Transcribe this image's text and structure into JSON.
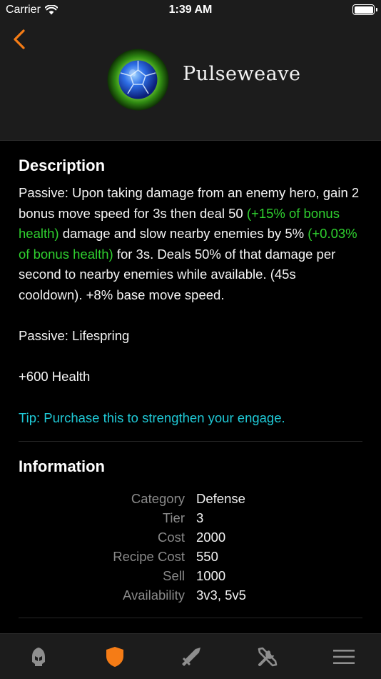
{
  "status_bar": {
    "carrier": "Carrier",
    "time": "1:39 AM",
    "battery_level": 1.0
  },
  "item": {
    "name": "Pulseweave",
    "icon": "pulseweave-orb-icon"
  },
  "description": {
    "title": "Description",
    "text_1": "Passive: Upon taking damage from an enemy hero, gain 2 bonus move speed for 3s then deal 50 ",
    "green_1": "(+15% of bonus health)",
    "text_2": " damage and slow nearby enemies by 5% ",
    "green_2": "(+0.03% of bonus health)",
    "text_3": " for 3s. Deals 50% of that damage per second to nearby enemies while available. (45s cooldown). +8% base move speed.",
    "passive": "Passive: Lifespring",
    "stat": "+600 Health",
    "tip": "Tip: Purchase this to strengthen your engage."
  },
  "information": {
    "title": "Information",
    "rows": [
      {
        "label": "Category",
        "value": "Defense"
      },
      {
        "label": "Tier",
        "value": "3"
      },
      {
        "label": "Cost",
        "value": "2000"
      },
      {
        "label": "Recipe Cost",
        "value": "550"
      },
      {
        "label": "Sell",
        "value": "1000"
      },
      {
        "label": "Availability",
        "value": "3v3, 5v5"
      }
    ]
  },
  "tabs": [
    {
      "icon": "helmet-icon",
      "active": false
    },
    {
      "icon": "shield-icon",
      "active": true
    },
    {
      "icon": "sword-icon",
      "active": false
    },
    {
      "icon": "tools-icon",
      "active": false
    },
    {
      "icon": "menu-icon",
      "active": false
    }
  ],
  "colors": {
    "accent": "#f57c16",
    "green": "#2fd02f",
    "tip": "#1fc9d6",
    "inactive_tab": "#8e8e8e"
  }
}
